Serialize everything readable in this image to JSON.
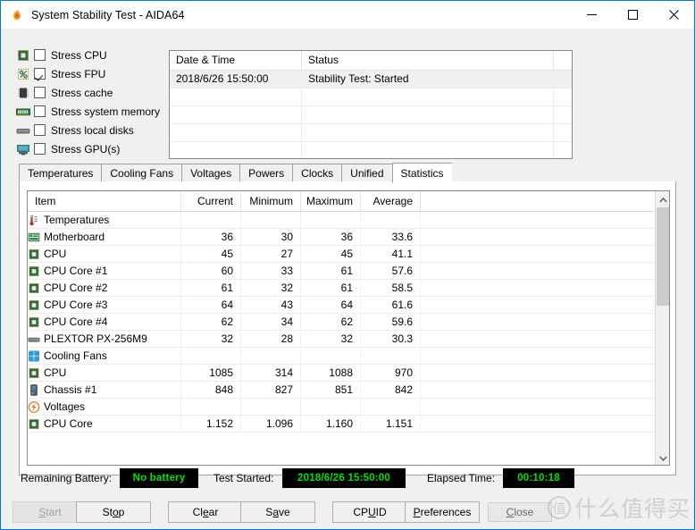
{
  "window": {
    "title": "System Stability Test - AIDA64",
    "app_icon": "flame-icon",
    "controls": {
      "minimize": "minimize-icon",
      "maximize": "maximize-icon",
      "close": "close-icon"
    }
  },
  "stress_options": [
    {
      "label": "Stress CPU",
      "checked": false,
      "icon": "cpu-chip-icon"
    },
    {
      "label": "Stress FPU",
      "checked": true,
      "icon": "fpu-percent-icon"
    },
    {
      "label": "Stress cache",
      "checked": false,
      "icon": "cache-chip-icon"
    },
    {
      "label": "Stress system memory",
      "checked": false,
      "icon": "memory-stick-icon"
    },
    {
      "label": "Stress local disks",
      "checked": false,
      "icon": "hard-disk-icon"
    },
    {
      "label": "Stress GPU(s)",
      "checked": false,
      "icon": "gpu-card-icon"
    }
  ],
  "log": {
    "headers": [
      "Date & Time",
      "Status",
      ""
    ],
    "rows": [
      {
        "datetime": "2018/6/26 15:50:00",
        "status": "Stability Test: Started",
        "extra": "",
        "selected": true
      },
      {
        "datetime": "",
        "status": "",
        "extra": "",
        "selected": false
      },
      {
        "datetime": "",
        "status": "",
        "extra": "",
        "selected": false
      },
      {
        "datetime": "",
        "status": "",
        "extra": "",
        "selected": false
      },
      {
        "datetime": "",
        "status": "",
        "extra": "",
        "selected": false
      },
      {
        "datetime": "",
        "status": "",
        "extra": "",
        "selected": false
      }
    ]
  },
  "tabs": [
    {
      "label": "Temperatures",
      "active": false
    },
    {
      "label": "Cooling Fans",
      "active": false
    },
    {
      "label": "Voltages",
      "active": false
    },
    {
      "label": "Powers",
      "active": false
    },
    {
      "label": "Clocks",
      "active": false
    },
    {
      "label": "Unified",
      "active": false
    },
    {
      "label": "Statistics",
      "active": true
    }
  ],
  "statistics": {
    "headers": [
      "Item",
      "Current",
      "Minimum",
      "Maximum",
      "Average"
    ],
    "rows": [
      {
        "item": "Temperatures",
        "icon": "thermometer-icon",
        "indent": 0,
        "group": true,
        "current": "",
        "minimum": "",
        "maximum": "",
        "average": ""
      },
      {
        "item": "Motherboard",
        "icon": "motherboard-icon",
        "indent": 1,
        "group": false,
        "current": "36",
        "minimum": "30",
        "maximum": "36",
        "average": "33.6"
      },
      {
        "item": "CPU",
        "icon": "cpu-chip-icon",
        "indent": 1,
        "group": false,
        "current": "45",
        "minimum": "27",
        "maximum": "45",
        "average": "41.1"
      },
      {
        "item": "CPU Core #1",
        "icon": "cpu-chip-icon",
        "indent": 1,
        "group": false,
        "current": "60",
        "minimum": "33",
        "maximum": "61",
        "average": "57.6"
      },
      {
        "item": "CPU Core #2",
        "icon": "cpu-chip-icon",
        "indent": 1,
        "group": false,
        "current": "61",
        "minimum": "32",
        "maximum": "61",
        "average": "58.5"
      },
      {
        "item": "CPU Core #3",
        "icon": "cpu-chip-icon",
        "indent": 1,
        "group": false,
        "current": "64",
        "minimum": "43",
        "maximum": "64",
        "average": "61.6"
      },
      {
        "item": "CPU Core #4",
        "icon": "cpu-chip-icon",
        "indent": 1,
        "group": false,
        "current": "62",
        "minimum": "34",
        "maximum": "62",
        "average": "59.6"
      },
      {
        "item": "PLEXTOR PX-256M9",
        "icon": "hard-disk-icon",
        "indent": 2,
        "group": false,
        "current": "32",
        "minimum": "28",
        "maximum": "32",
        "average": "30.3"
      },
      {
        "item": "Cooling Fans",
        "icon": "fan-icon",
        "indent": 0,
        "group": true,
        "current": "",
        "minimum": "",
        "maximum": "",
        "average": ""
      },
      {
        "item": "CPU",
        "icon": "cpu-chip-icon",
        "indent": 1,
        "group": false,
        "current": "1085",
        "minimum": "314",
        "maximum": "1088",
        "average": "970"
      },
      {
        "item": "Chassis #1",
        "icon": "chassis-tower-icon",
        "indent": 2,
        "group": false,
        "current": "848",
        "minimum": "827",
        "maximum": "851",
        "average": "842"
      },
      {
        "item": "Voltages",
        "icon": "lightning-bolt-icon",
        "indent": 0,
        "group": true,
        "current": "",
        "minimum": "",
        "maximum": "",
        "average": ""
      },
      {
        "item": "CPU Core",
        "icon": "cpu-chip-icon",
        "indent": 1,
        "group": false,
        "current": "1.152",
        "minimum": "1.096",
        "maximum": "1.160",
        "average": "1.151"
      }
    ],
    "scrollbar": {
      "up_icon": "chevron-up-icon",
      "down_icon": "chevron-down-icon",
      "thumb_position": "top"
    }
  },
  "status_bar": {
    "battery_label": "Remaining Battery:",
    "battery_value": "No battery",
    "started_label": "Test Started:",
    "started_value": "2018/6/26 15:50:00",
    "elapsed_label": "Elapsed Time:",
    "elapsed_value": "00:10:18",
    "lcd_text_color": "#00e000",
    "lcd_bg_color": "#000000"
  },
  "buttons": [
    {
      "label": "Start",
      "mnemonic": "S",
      "disabled": true
    },
    {
      "label": "Stop",
      "mnemonic": "o",
      "disabled": false
    },
    {
      "label": "Clear",
      "mnemonic": "e",
      "disabled": false
    },
    {
      "label": "Save",
      "mnemonic": "a",
      "disabled": false
    },
    {
      "label": "CPUID",
      "mnemonic": "U",
      "disabled": false
    },
    {
      "label": "Preferences",
      "mnemonic": "P",
      "disabled": false
    },
    {
      "label": "Close",
      "mnemonic": "C",
      "disabled": false
    }
  ],
  "watermark": {
    "logo_char": "值",
    "text": "什么值得买"
  }
}
